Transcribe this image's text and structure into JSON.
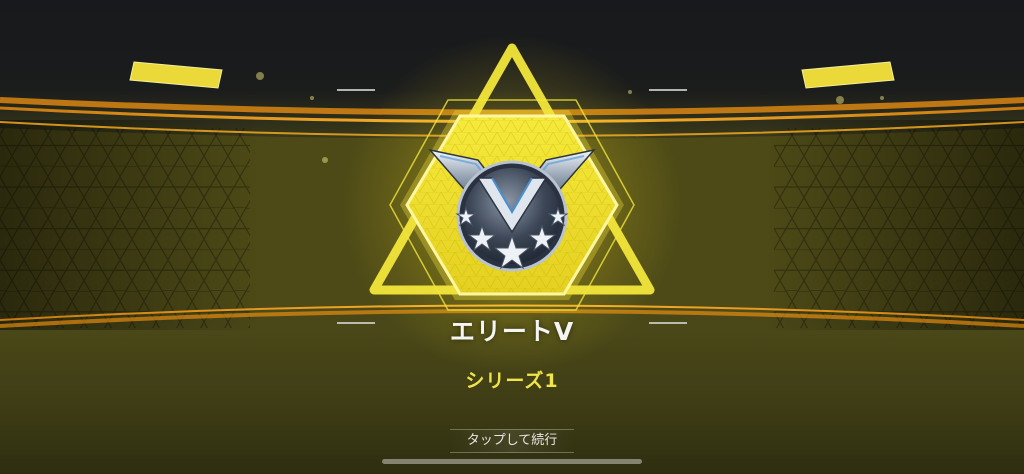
{
  "rank": {
    "title": "エリートⅤ",
    "season": "シリーズ1",
    "emblem_icon": "winged-shield-emblem-with-stars",
    "stars": 3
  },
  "continue_button": {
    "label": "タップして続行"
  },
  "colors": {
    "accent_yellow": "#f2e63a",
    "band_orange": "#f0a020",
    "background_dark": "#17191c",
    "background_olive": "#4a4818",
    "title_text": "#f4f4f2",
    "season_text": "#f0e44a"
  }
}
